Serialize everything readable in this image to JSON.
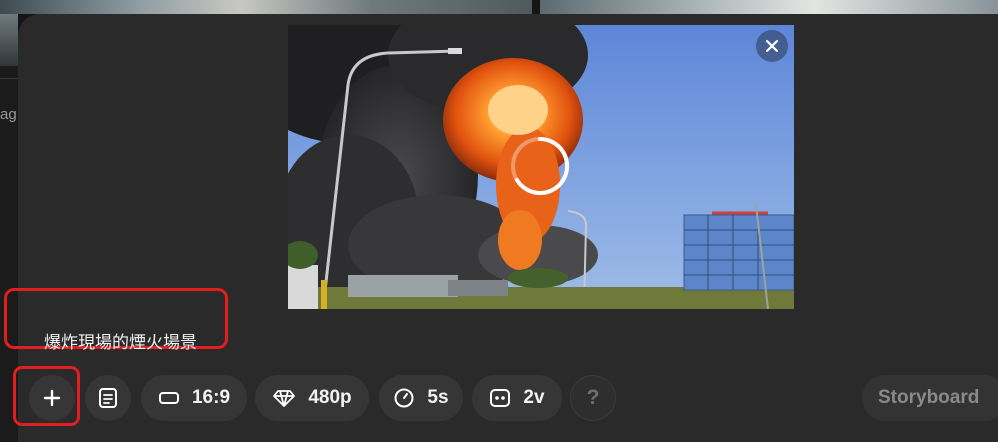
{
  "prompt": {
    "text": "爆炸現場的煙火場景"
  },
  "background": {
    "left_partial_text": "ag"
  },
  "toolbar": {
    "add_icon": "plus-icon",
    "prompt_icon": "list-card-icon",
    "aspect_ratio": {
      "icon": "rectangle-icon",
      "label": "16:9"
    },
    "resolution": {
      "icon": "diamond-icon",
      "label": "480p"
    },
    "duration": {
      "icon": "clock-icon",
      "label": "5s"
    },
    "variations": {
      "icon": "dots-box-icon",
      "label": "2v"
    },
    "help_label": "?",
    "storyboard_label": "Storyboard"
  },
  "preview": {
    "close_icon": "close-icon",
    "loading_icon": "spinner-icon"
  },
  "colors": {
    "annotation_red": "#e21e1e",
    "modal_bg": "#2a2a2a",
    "button_bg": "#363636"
  }
}
